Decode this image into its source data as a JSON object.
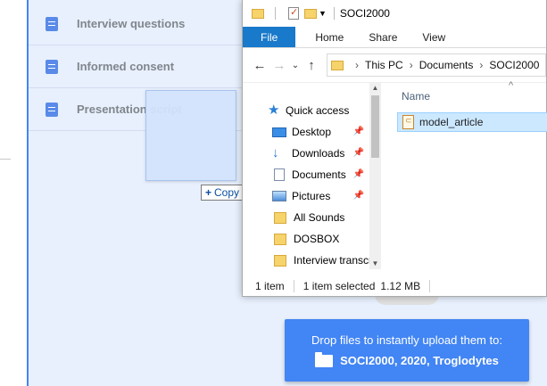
{
  "drive": {
    "files": [
      {
        "name": "Interview questions"
      },
      {
        "name": "Informed consent"
      },
      {
        "name": "Presentation script"
      }
    ],
    "drag_tooltip": {
      "plus": "+",
      "label": "Copy"
    },
    "drop_banner": {
      "line1": "Drop files to instantly upload them to:",
      "destination": "SOCI2000, 2020, Troglodytes"
    }
  },
  "explorer": {
    "title": "SOCI2000",
    "ribbon_tabs": [
      "File",
      "Home",
      "Share",
      "View"
    ],
    "address": [
      "This PC",
      "Documents",
      "SOCI2000"
    ],
    "nav_items": [
      {
        "label": "Quick access",
        "icon": "star-icon",
        "pinned": false
      },
      {
        "label": "Desktop",
        "icon": "desktop-icon",
        "pinned": true
      },
      {
        "label": "Downloads",
        "icon": "download-icon",
        "pinned": true
      },
      {
        "label": "Documents",
        "icon": "document-icon",
        "pinned": true
      },
      {
        "label": "Pictures",
        "icon": "picture-icon",
        "pinned": true
      },
      {
        "label": "All Sounds",
        "icon": "folder-icon",
        "pinned": false
      },
      {
        "label": "DOSBOX",
        "icon": "folder-icon",
        "pinned": false
      },
      {
        "label": "Interview transcr",
        "icon": "folder-icon",
        "pinned": false
      }
    ],
    "column_header": "Name",
    "file": {
      "name": "model_article"
    },
    "status": {
      "count": "1 item",
      "selected": "1 item selected",
      "size": "1.12 MB"
    }
  },
  "colors": {
    "accent": "#4285f4",
    "file_tab": "#1979ca",
    "selection": "#cce8ff",
    "drop_zone": "#e8f0fe"
  }
}
